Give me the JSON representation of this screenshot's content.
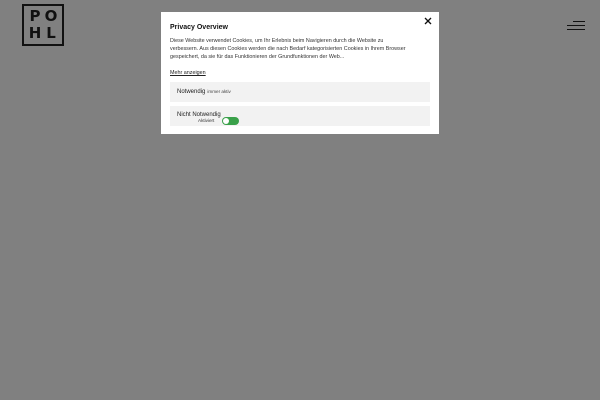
{
  "header": {
    "logo_letters": [
      "P",
      "O",
      "H",
      "L"
    ],
    "menu_icon": "hamburger-menu-icon"
  },
  "modal": {
    "title": "Privacy Overview",
    "description": "Diese Website verwendet Cookies, um Ihr Erlebnis beim Navigieren durch die Website zu verbessern. Aus diesen Cookies werden die nach Bedarf kategorisierten Cookies in Ihrem Browser gespeichert, da sie für das Funktionieren der Grundfunktionen der Web...",
    "more_link": "Mehr anzeigen",
    "close_icon": "close-icon",
    "categories": [
      {
        "title": "Notwendig",
        "badge": "immer aktiv"
      },
      {
        "title": "Nicht Notwendig",
        "toggle_label": "Aktiviert",
        "toggle_on": true
      }
    ]
  },
  "colors": {
    "background_overlay": "#808080",
    "modal_bg": "#ffffff",
    "panel_bg": "#f2f2f2",
    "toggle_on": "#3aa14a"
  }
}
